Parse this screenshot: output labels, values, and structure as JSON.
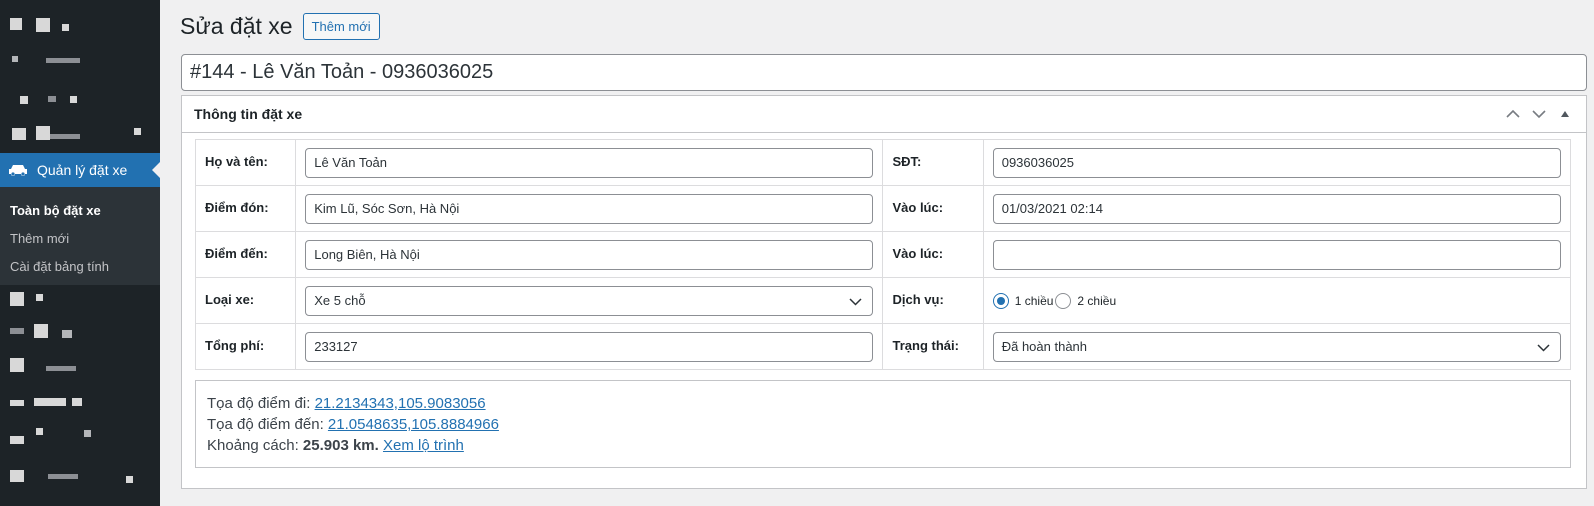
{
  "sidebar": {
    "active_menu": "Quản lý đặt xe",
    "submenu": [
      {
        "label": "Toàn bộ đặt xe",
        "current": true
      },
      {
        "label": "Thêm mới",
        "current": false
      },
      {
        "label": "Cài đặt bảng tính",
        "current": false
      }
    ]
  },
  "header": {
    "title": "Sửa đặt xe",
    "add_new_label": "Thêm mới"
  },
  "post_title": "#144 - Lê Văn Toản - 0936036025",
  "postbox": {
    "title": "Thông tin đặt xe"
  },
  "form": {
    "name_label": "Họ và tên:",
    "name_value": "Lê Văn Toản",
    "phone_label": "SĐT:",
    "phone_value": "0936036025",
    "pickup_label": "Điểm đón:",
    "pickup_value": "Kim Lũ, Sóc Sơn, Hà Nội",
    "pickup_time_label": "Vào lúc:",
    "pickup_time_value": "01/03/2021 02:14",
    "dropoff_label": "Điểm đến:",
    "dropoff_value": "Long Biên, Hà Nội",
    "dropoff_time_label": "Vào lúc:",
    "dropoff_time_value": "",
    "car_type_label": "Loại xe:",
    "car_type_value": "Xe 5 chỗ",
    "service_label": "Dịch vụ:",
    "service_options": [
      "1 chiều",
      "2 chiều"
    ],
    "service_selected": "1 chiều",
    "total_label": "Tổng phí:",
    "total_value": "233127",
    "status_label": "Trạng thái:",
    "status_value": "Đã hoàn thành"
  },
  "info": {
    "from_label": "Tọa độ điểm đi: ",
    "from_coords": "21.2134343,105.9083056",
    "to_label": "Tọa độ điểm đến: ",
    "to_coords": "21.0548635,105.8884966",
    "distance_label": "Khoảng cách: ",
    "distance_value": "25.903 km.",
    "route_link": "Xem lộ trình"
  },
  "colors": {
    "sidebar_bg": "#1d2327",
    "accent": "#2271b1",
    "page_bg": "#f0f0f1"
  }
}
